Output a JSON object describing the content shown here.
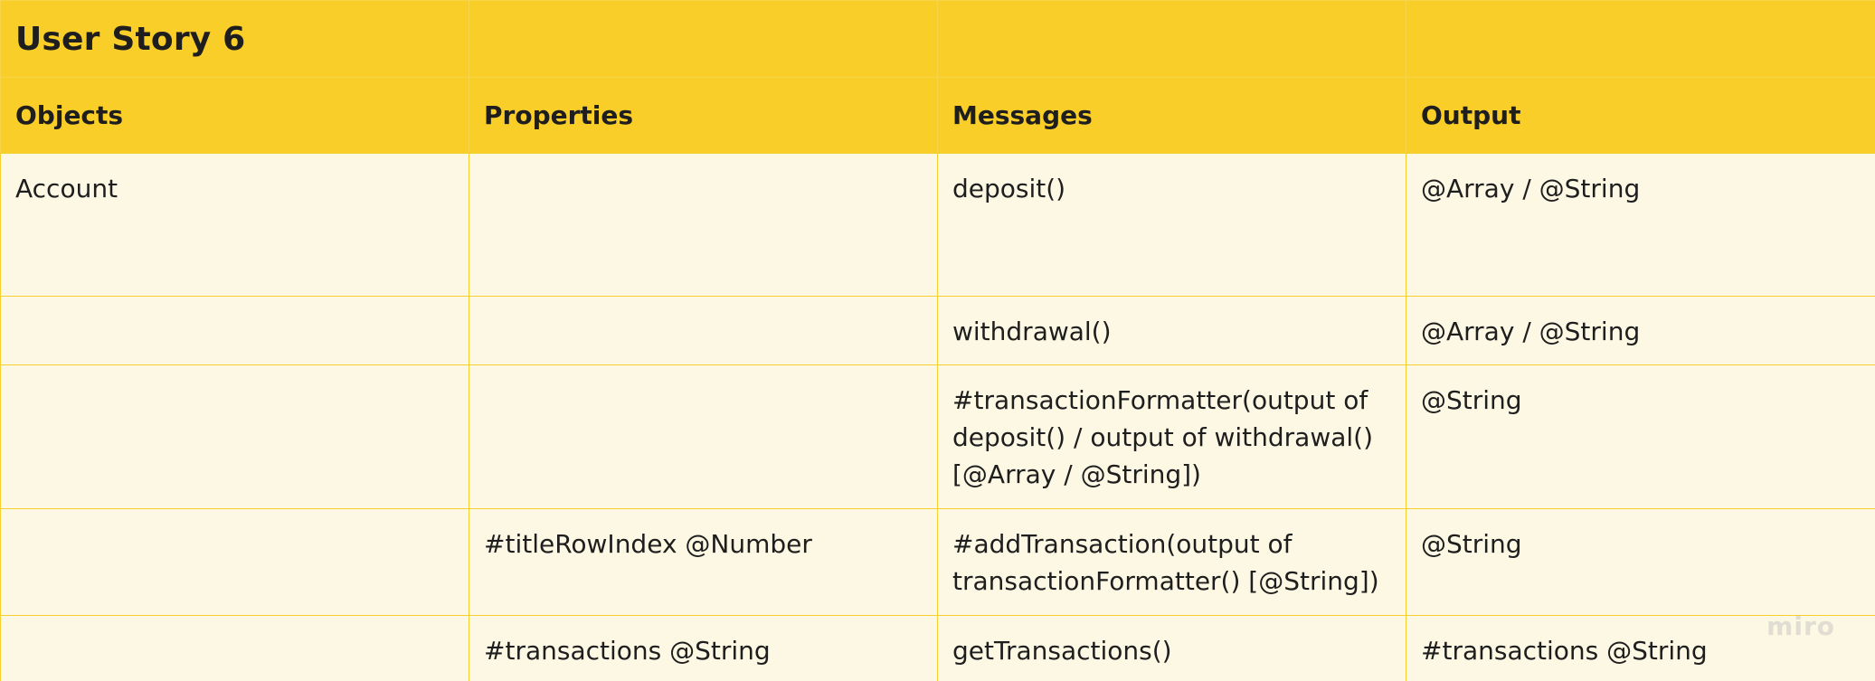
{
  "title": "User Story 6",
  "headers": [
    "Objects",
    "Properties",
    "Messages",
    "Output"
  ],
  "rows": [
    {
      "objects": "Account",
      "properties": "",
      "messages": "deposit()",
      "output": "@Array / @String"
    },
    {
      "objects": "",
      "properties": "",
      "messages": "withdrawal()",
      "output": "@Array / @String"
    },
    {
      "objects": "",
      "properties": "",
      "messages": "#transactionFormatter(output of deposit() / output of withdrawal() [@Array / @String])",
      "output": "@String"
    },
    {
      "objects": "",
      "properties": "#titleRowIndex @Number",
      "messages": "#addTransaction(output of transactionFormatter() [@String])",
      "output": "@String"
    },
    {
      "objects": "",
      "properties": "#transactions @String",
      "messages": "getTransactions()",
      "output": "#transactions @String"
    }
  ],
  "watermark": "miro",
  "colors": {
    "header_bg": "#f9ce28",
    "cell_bg": "#fdf8e4",
    "border": "#f5cf2e",
    "text": "#1e1e1e"
  }
}
